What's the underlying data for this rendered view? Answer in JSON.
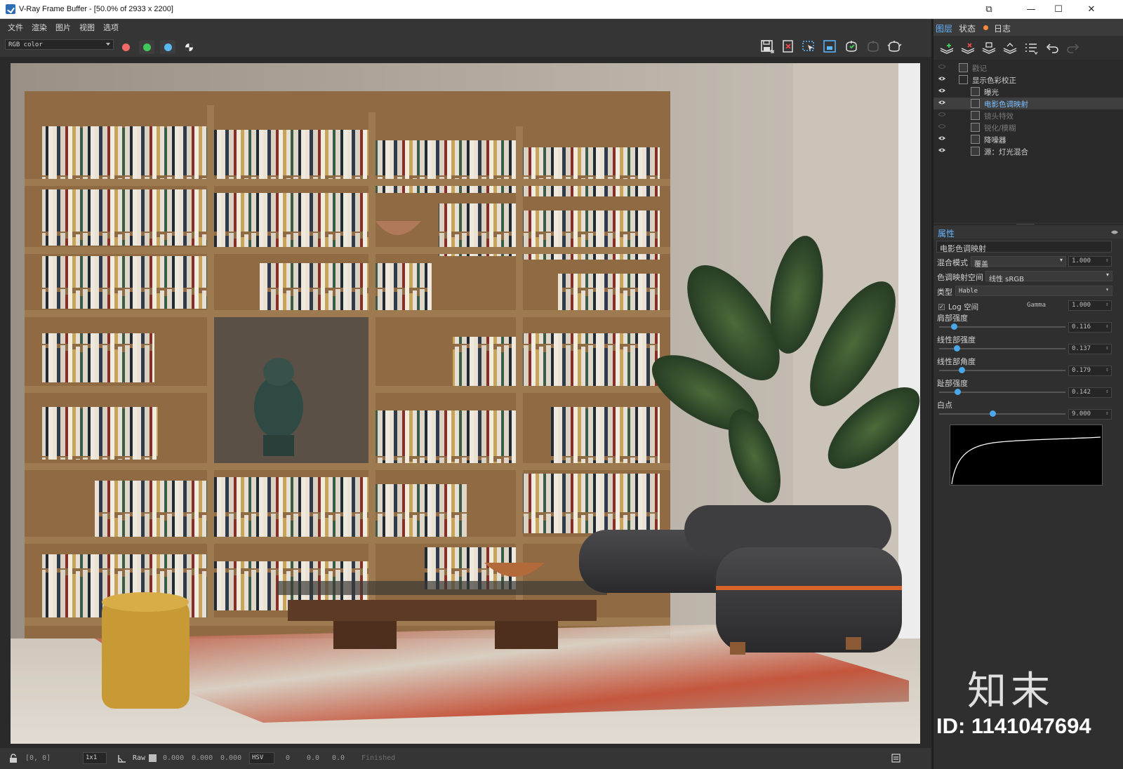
{
  "window": {
    "title": "V-Ray Frame Buffer - [50.0% of 2933 x 2200]",
    "minimize_glyph": "—",
    "maximize_glyph": "☐",
    "close_glyph": "✕",
    "restore_glyph": "⧉"
  },
  "menu": [
    "文件",
    "渲染",
    "图片",
    "视图",
    "选项"
  ],
  "toolbar": {
    "channel_select": "RGB color",
    "channel_colors": {
      "red": "#f06a6a",
      "green": "#3ec95a",
      "blue": "#59b8f0"
    },
    "icons": [
      "save-icon",
      "clear-image-icon",
      "region-render-icon",
      "track-mouse-icon",
      "render-icon",
      "stop-render-icon",
      "teapot-icon"
    ]
  },
  "status": {
    "coords": "[0, 0]",
    "zoom_select": "1x1",
    "raw_label": "Raw",
    "raw_values": [
      "0.000",
      "0.000",
      "0.000"
    ],
    "mode_select": "HSV",
    "hsv_values": [
      "0",
      "0.0",
      "0.0"
    ],
    "state": "Finished"
  },
  "panel": {
    "tabs": [
      "图层",
      "状态",
      "日志"
    ],
    "layers": [
      {
        "name": "戳记",
        "visible": false,
        "indent": 0
      },
      {
        "name": "显示色彩校正",
        "visible": true,
        "indent": 0
      },
      {
        "name": "曝光",
        "visible": true,
        "indent": 1
      },
      {
        "name": "电影色调映射",
        "visible": true,
        "indent": 1,
        "selected": true
      },
      {
        "name": "镜头特效",
        "visible": false,
        "indent": 1
      },
      {
        "name": "锐化/模糊",
        "visible": false,
        "indent": 1
      },
      {
        "name": "降噪器",
        "visible": true,
        "indent": 1
      },
      {
        "name": "源：灯光混合",
        "visible": true,
        "indent": 1
      }
    ],
    "properties_title": "属性",
    "properties": {
      "layer_name": "电影色调映射",
      "blend_mode_label": "混合模式",
      "blend_mode": "覆盖",
      "blend_amount": "1.000",
      "tonemap_space_label": "色调映射空间",
      "tonemap_space": "线性 sRGB",
      "type_label": "类型",
      "type": "Hable",
      "log_space_label": "Log 空间",
      "log_space_checked": true,
      "gamma_label": "Gamma",
      "gamma": "1.000",
      "sliders": [
        {
          "label": "肩部强度",
          "value": "0.116",
          "fraction": 0.116
        },
        {
          "label": "线性部强度",
          "value": "0.137",
          "fraction": 0.137
        },
        {
          "label": "线性部角度",
          "value": "0.179",
          "fraction": 0.179
        },
        {
          "label": "趾部强度",
          "value": "0.142",
          "fraction": 0.142
        },
        {
          "label": "白点",
          "value": "9.000",
          "fraction": 0.42
        }
      ]
    }
  },
  "watermark": {
    "logo_text": "知末",
    "id_text": "ID: 1141047694"
  }
}
